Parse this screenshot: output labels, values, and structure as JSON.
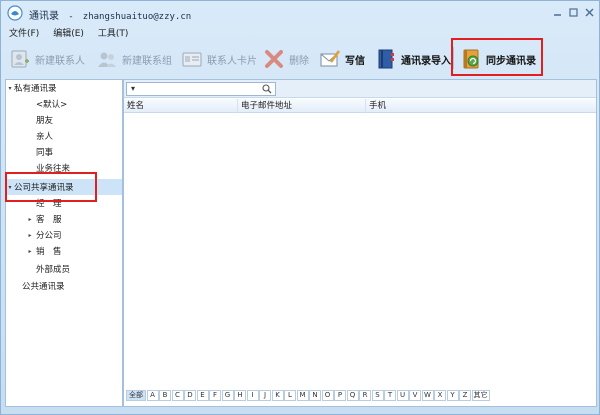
{
  "window": {
    "title": "通讯录",
    "account": "zhangshuaituo@zzy.cn"
  },
  "menu": [
    "文件(F)",
    "编辑(E)",
    "工具(T)"
  ],
  "toolbar": {
    "new_contact": "新建联系人",
    "new_group": "新建联系组",
    "contact_card": "联系人卡片",
    "delete": "删除",
    "write": "写信",
    "import": "通讯录导入",
    "sync": "同步通讯录"
  },
  "tree": {
    "private": "私有通讯录",
    "default": "<默认>",
    "friends": "朋友",
    "family": "亲人",
    "colleagues": "同事",
    "business": "业务往来",
    "company": "公司共享通讯录",
    "manager": "经　理",
    "customer_service": "客　服",
    "branch": "分公司",
    "sales": "销　售",
    "external": "外部成员",
    "public": "公共通讯录"
  },
  "search": {
    "dropdown": "▾",
    "placeholder": ""
  },
  "columns": [
    "姓名",
    "电子邮件地址",
    "手机"
  ],
  "alphabet": [
    "全部",
    "A",
    "B",
    "C",
    "D",
    "E",
    "F",
    "G",
    "H",
    "I",
    "J",
    "K",
    "L",
    "M",
    "N",
    "O",
    "P",
    "Q",
    "R",
    "S",
    "T",
    "U",
    "V",
    "W",
    "X",
    "Y",
    "Z",
    "其它"
  ],
  "colors": {
    "highlight": "#e02020",
    "selection": "#cde4f8"
  }
}
